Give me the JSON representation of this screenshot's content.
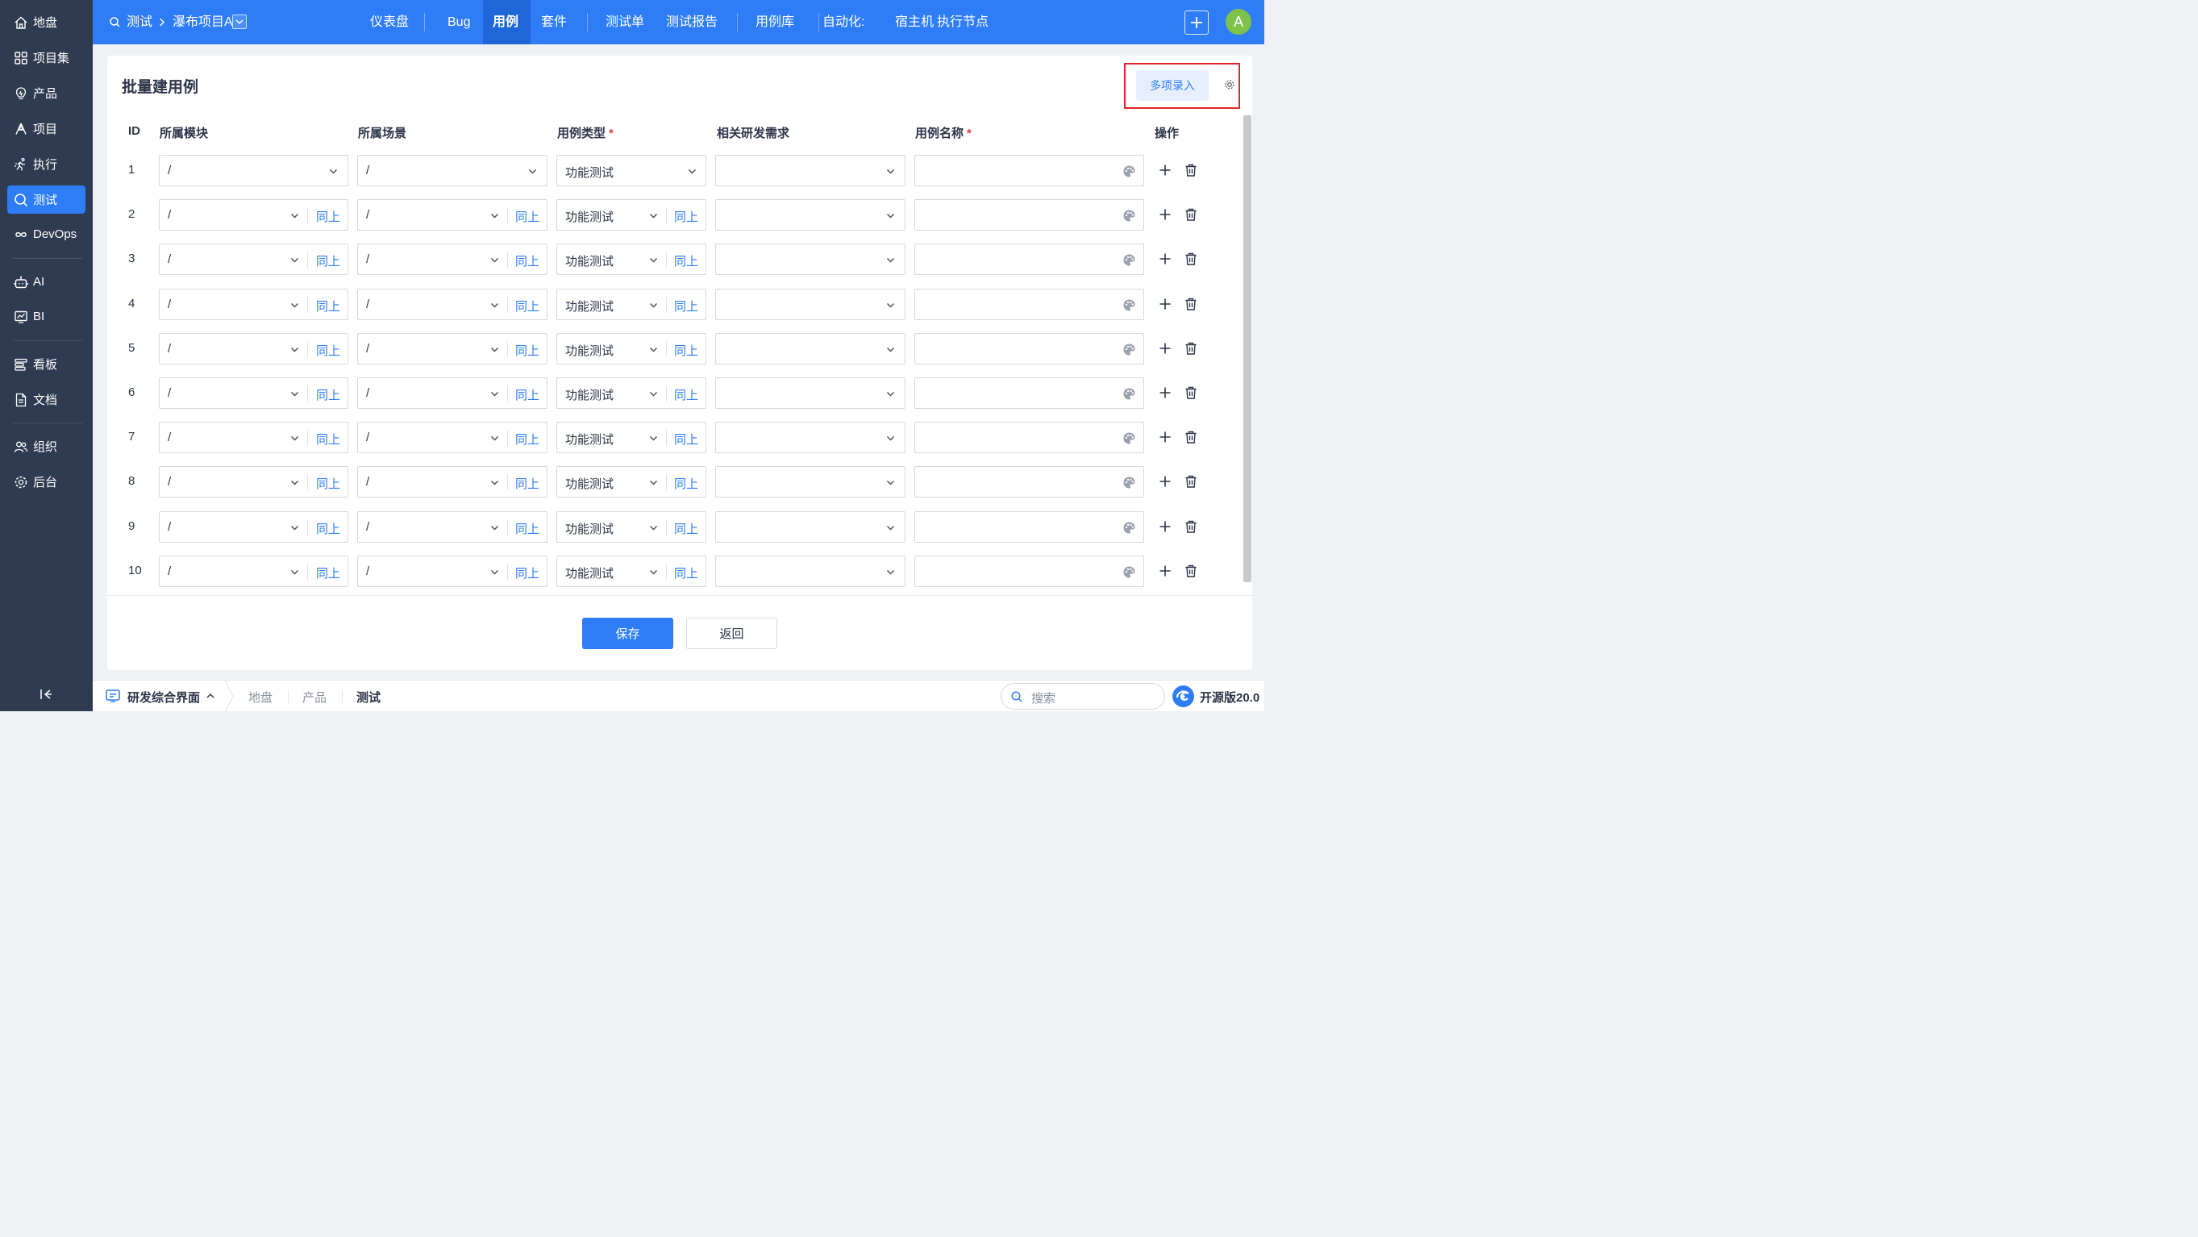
{
  "sidebar": {
    "items": [
      {
        "label": "地盘",
        "icon": "home-icon"
      },
      {
        "label": "项目集",
        "icon": "grid-icon"
      },
      {
        "label": "产品",
        "icon": "bulb-icon"
      },
      {
        "label": "项目",
        "icon": "project-icon"
      },
      {
        "label": "执行",
        "icon": "run-icon"
      },
      {
        "label": "测试",
        "icon": "search-test-icon",
        "active": true
      },
      {
        "label": "DevOps",
        "icon": "infinity-icon"
      },
      {
        "label": "AI",
        "icon": "robot-icon"
      },
      {
        "label": "BI",
        "icon": "chart-icon"
      },
      {
        "label": "看板",
        "icon": "kanban-icon"
      },
      {
        "label": "文档",
        "icon": "doc-icon"
      },
      {
        "label": "组织",
        "icon": "people-icon"
      },
      {
        "label": "后台",
        "icon": "gear-icon"
      }
    ]
  },
  "topbar": {
    "breadcrumb": {
      "root": "测试",
      "current": "瀑布项目A"
    },
    "tabs": [
      "仪表盘",
      "Bug",
      "用例",
      "套件",
      "测试单",
      "测试报告",
      "用例库",
      "自动化:",
      "宿主机",
      "执行节点"
    ],
    "active_tab": "用例",
    "avatar": "A"
  },
  "page": {
    "title": "批量建用例",
    "multi_entry_button": "多项录入",
    "columns": {
      "id": "ID",
      "module": "所属模块",
      "scene": "所属场景",
      "type": "用例类型",
      "story": "相关研发需求",
      "name": "用例名称",
      "actions": "操作"
    },
    "required_mark": "*",
    "rows": [
      {
        "id": "1",
        "module": "/",
        "scene": "/",
        "type": "功能测试"
      },
      {
        "id": "2",
        "module": "/",
        "scene": "/",
        "type": "功能测试"
      },
      {
        "id": "3",
        "module": "/",
        "scene": "/",
        "type": "功能测试"
      },
      {
        "id": "4",
        "module": "/",
        "scene": "/",
        "type": "功能测试"
      },
      {
        "id": "5",
        "module": "/",
        "scene": "/",
        "type": "功能测试"
      },
      {
        "id": "6",
        "module": "/",
        "scene": "/",
        "type": "功能测试"
      },
      {
        "id": "7",
        "module": "/",
        "scene": "/",
        "type": "功能测试"
      },
      {
        "id": "8",
        "module": "/",
        "scene": "/",
        "type": "功能测试"
      },
      {
        "id": "9",
        "module": "/",
        "scene": "/",
        "type": "功能测试"
      },
      {
        "id": "10",
        "module": "/",
        "scene": "/",
        "type": "功能测试"
      }
    ],
    "ditto_label": "同上",
    "save_button": "保存",
    "back_button": "返回"
  },
  "bottombar": {
    "app_switcher": "研发综合界面",
    "crumbs": [
      "地盘",
      "产品",
      "测试"
    ],
    "search_placeholder": "搜索",
    "version": "开源版20.0"
  },
  "colors": {
    "primary": "#2e7df6",
    "sidebar_bg": "#2f3b50",
    "highlight": "#e0262a",
    "required": "#e33d3d",
    "avatar": "#7ec24a"
  }
}
